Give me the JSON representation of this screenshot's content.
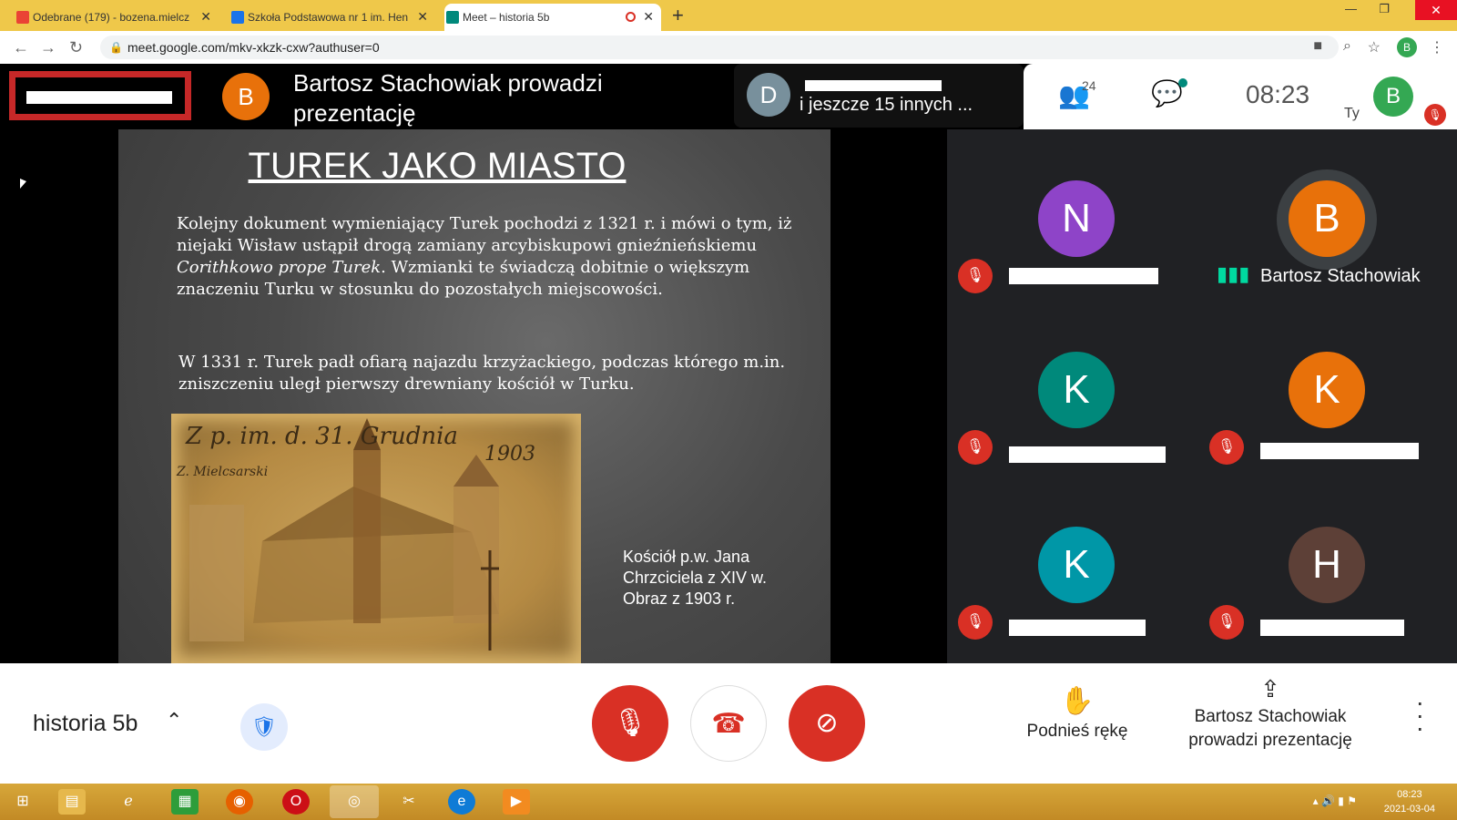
{
  "browser": {
    "tabs": [
      {
        "title": "Odebrane (179) - bozena.mielcz",
        "icon": "gmail-icon",
        "active": false
      },
      {
        "title": "Szkoła Podstawowa nr 1 im. Hen",
        "icon": "classroom-icon",
        "active": false
      },
      {
        "title": "Meet – historia 5b",
        "icon": "meet-icon",
        "active": true
      }
    ],
    "url": "meet.google.com/mkv-xkzk-cxw?authuser=0",
    "profile_initial": "B"
  },
  "meet_top": {
    "presenter_initial": "B",
    "presenter_title": "Bartosz Stachowiak prowadzi prezentację",
    "other_initial": "D",
    "others_text": "i jeszcze 15 innych ...",
    "participant_count": "24",
    "time": "08:23",
    "self_label": "Ty",
    "self_initial": "B"
  },
  "slide": {
    "title": "TUREK JAKO MIASTO",
    "paragraph1_part1": "Kolejny dokument wymieniający Turek pochodzi z 1321 r. i mówi o tym, iż niejaki Wisław ustąpił drogą zamiany arcybiskupowi gnieźnieńskiemu ",
    "paragraph1_italic": "Corithkowo prope Turek",
    "paragraph1_part2": ". Wzmianki te świadczą dobitnie o większym znaczeniu Turku w stosunku do pozostałych miejscowości.",
    "paragraph2": "W 1331 r. Turek padł ofiarą najazdu krzyżackiego, podczas którego m.in. zniszczeniu uległ pierwszy drewniany kościół w Turku.",
    "painting_line1": "Z p. im.   d. 31. Grudnia",
    "painting_line2": "1903",
    "painting_signature": "Z. Mielcsarski",
    "caption": [
      "Kościół  p.w. Jana",
      "Chrzciciela z XIV w.",
      "Obraz z 1903 r."
    ]
  },
  "participants": [
    {
      "initial": "N",
      "color": "#8e44c8",
      "name": ""
    },
    {
      "initial": "B",
      "color": "#e8710a",
      "name": "Bartosz Stachowiak",
      "speaking": true
    },
    {
      "initial": "K",
      "color": "#00897b",
      "name": ""
    },
    {
      "initial": "K",
      "color": "#e8710a",
      "name": ""
    },
    {
      "initial": "K",
      "color": "#0097a7",
      "name": ""
    },
    {
      "initial": "H",
      "color": "#5d4037",
      "name": ""
    }
  ],
  "bottom": {
    "meeting_name": "historia 5b",
    "raise_hand": "Podnieś rękę",
    "presenting_line1": "Bartosz Stachowiak",
    "presenting_line2": "prowadzi prezentację"
  },
  "taskbar": {
    "time": "08:23",
    "date": "2021-03-04"
  }
}
